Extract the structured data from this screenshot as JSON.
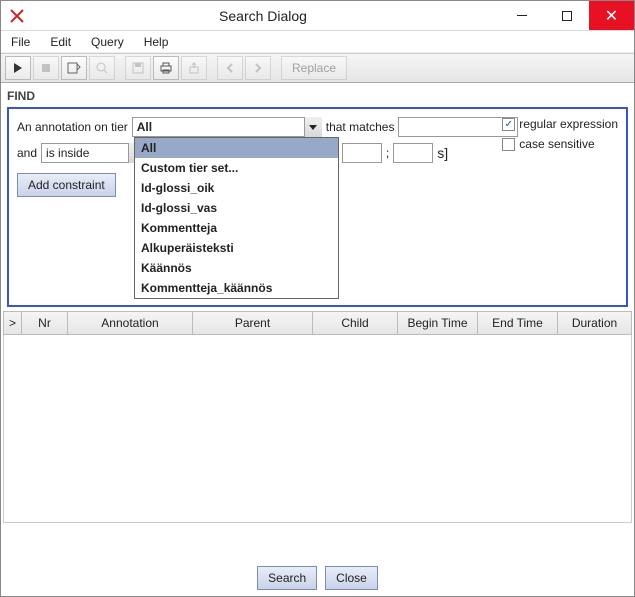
{
  "window": {
    "title": "Search Dialog"
  },
  "menu": {
    "file": "File",
    "edit": "Edit",
    "query": "Query",
    "help": "Help"
  },
  "toolbar": {
    "replace": "Replace"
  },
  "find": {
    "heading": "FIND",
    "label_annotation_on_tier": "An annotation on tier",
    "tier_selected": "All",
    "label_that_matches": "that matches",
    "match_value": "",
    "label_and": "and",
    "inside_selected": "is inside",
    "interval_open": "[",
    "time_from": "",
    "time_mid": "; ",
    "time_to": "",
    "interval_close": "s]",
    "regex_label": "regular expression",
    "regex_checked": "✓",
    "case_label": "case sensitive",
    "add_constraint": "Add constraint",
    "tier_options": [
      "All",
      "Custom tier set...",
      "Id-glossi_oik",
      "Id-glossi_vas",
      "Kommentteja",
      "Alkuperäisteksti",
      "Käännös",
      "Kommentteja_käännös"
    ]
  },
  "table": {
    "ix": ">",
    "nr": "Nr",
    "annotation": "Annotation",
    "parent": "Parent",
    "child": "Child",
    "begin_time": "Begin Time",
    "end_time": "End Time",
    "duration": "Duration"
  },
  "buttons": {
    "search": "Search",
    "close": "Close"
  }
}
